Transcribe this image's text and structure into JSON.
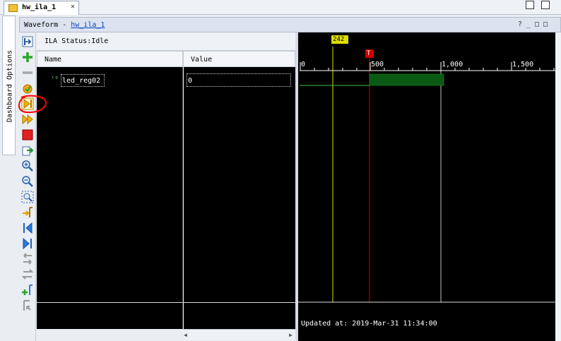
{
  "tab": {
    "label": "hw_ila_1",
    "close": "✕"
  },
  "window_controls": {
    "restore": "□",
    "maximize": "□"
  },
  "dock": {
    "label": "Dashboard Options"
  },
  "waveform_header": {
    "title_prefix": "Waveform - ",
    "link": "hw_ila_1",
    "icons": "?_□□"
  },
  "ila_status": {
    "text": "ILA Status:Idle"
  },
  "columns": {
    "name": "Name",
    "value": "Value"
  },
  "signals": [
    {
      "name": "led_reg02",
      "value": "0"
    }
  ],
  "timeline": {
    "cursor_label": "242",
    "marker_label": "T",
    "ticks": [
      "0",
      "500",
      "1,000",
      "1,500"
    ],
    "updated_text": "Updated at: 2019-Mar-31 11:34:00"
  },
  "colors": {
    "wave_bg": "#000000",
    "signal_low": "#3fbf3f",
    "signal_high_fill": "#0a5a14",
    "cursor_yellow": "#dede00",
    "marker_red": "#cc0000",
    "annotation_red": "#ff0000"
  },
  "toolbar_icons": [
    "toggle-settings-icon",
    "add-probe-icon",
    "remove-icon",
    "run-trigger-icon",
    "run-trigger-immediate-icon",
    "run-continuous-icon",
    "stop-icon",
    "export-icon",
    "zoom-in-icon",
    "zoom-out-icon",
    "zoom-fit-icon",
    "go-to-cursor-icon",
    "previous-transition-icon",
    "next-transition-icon",
    "add-marker-icon",
    "swap-cursors-icon",
    "add-marker-plus-icon",
    "move-marker-icon"
  ]
}
